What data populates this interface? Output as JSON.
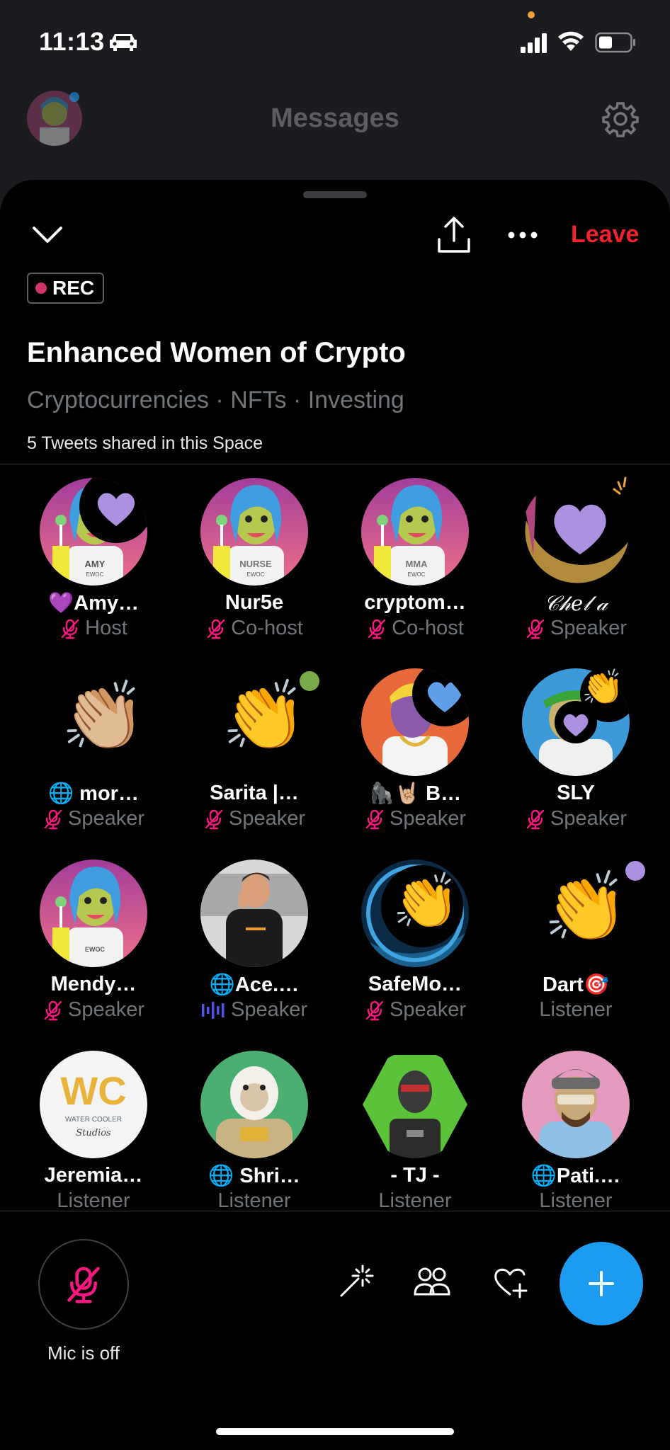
{
  "status_bar": {
    "time": "11:13"
  },
  "messages_header": {
    "title": "Messages"
  },
  "space": {
    "leave_label": "Leave",
    "rec_label": "REC",
    "title": "Enhanced Women of Crypto",
    "topics": "Cryptocurrencies · NFTs · Investing",
    "tweets_shared": "5 Tweets shared in this Space"
  },
  "participants": [
    {
      "name": "💜Amy…",
      "role": "Host"
    },
    {
      "name": "Nur5e",
      "role": "Co-host"
    },
    {
      "name": "cryptom…",
      "role": "Co-host"
    },
    {
      "name": "𝒞𝒽𝑒𝓁 𝒶",
      "role": "Speaker"
    },
    {
      "name": "🌐 mor…",
      "role": "Speaker"
    },
    {
      "name": "Sarita |…",
      "role": "Speaker"
    },
    {
      "name": "🦍🤘🏼 B…",
      "role": "Speaker"
    },
    {
      "name": "SLY",
      "role": "Speaker"
    },
    {
      "name": "Mendy…",
      "role": "Speaker"
    },
    {
      "name": "🌐Ace.…",
      "role": "Speaker"
    },
    {
      "name": "SafeMo…",
      "role": "Speaker"
    },
    {
      "name": "Dart🎯",
      "role": "Listener"
    },
    {
      "name": "Jeremia…",
      "role": "Listener"
    },
    {
      "name": "🌐 Shri…",
      "role": "Listener"
    },
    {
      "name": "- TJ -",
      "role": "Listener"
    },
    {
      "name": "🌐Pati.…",
      "role": "Listener"
    }
  ],
  "avatar_text": {
    "amy_shirt": "AMY",
    "amy_shirt_sub": "EWOC",
    "nurse_shirt": "NURSE",
    "nurse_shirt_sub": "EWOC",
    "mma_shirt": "MMA",
    "mma_shirt_sub": "EWOC",
    "mendy_shirt": "EWOC",
    "jeremia_logo": "WC",
    "jeremia_sub": "WATER COOLER",
    "jeremia_script": "Studios"
  },
  "bottom_bar": {
    "mic_label": "Mic is off"
  },
  "colors": {
    "accent": "#1d9bf0",
    "leave": "#f4212e",
    "rec_dot": "#d0346a",
    "muted_mic": "#f91880",
    "heart": "#ab91e0"
  },
  "icons": [
    "car-icon",
    "signal-icon",
    "wifi-icon",
    "battery-icon",
    "gear-icon",
    "chevron-down-icon",
    "share-icon",
    "more-icon",
    "mic-off-icon",
    "sparkle-icon",
    "people-icon",
    "heart-plus-icon",
    "plus-icon"
  ]
}
